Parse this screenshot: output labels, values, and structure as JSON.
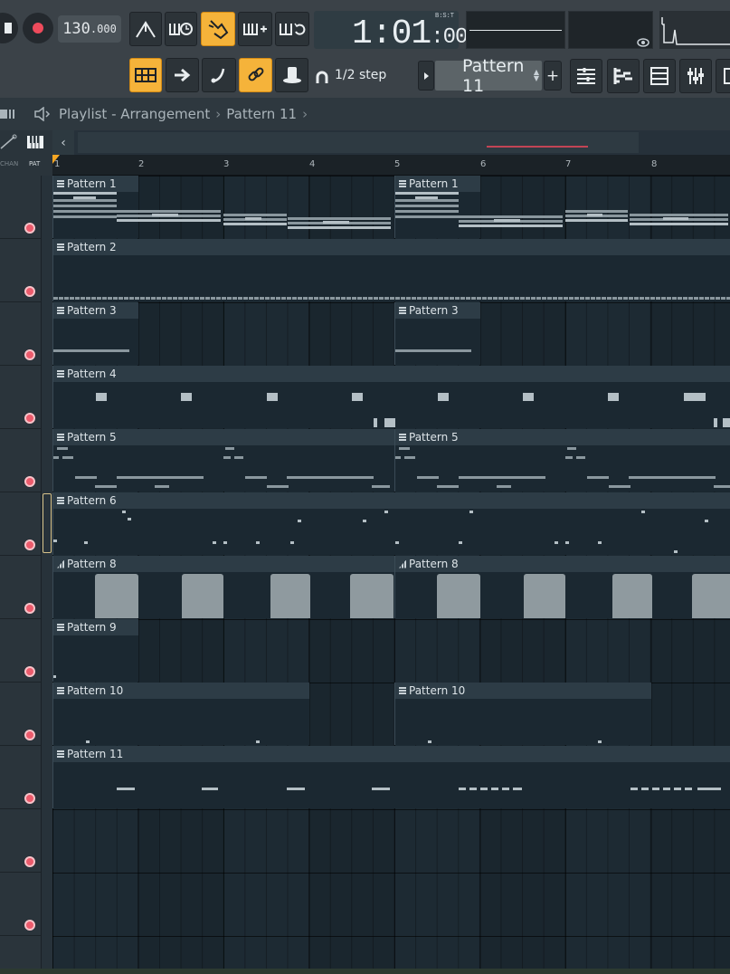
{
  "toolbar": {
    "tempo_main": "130",
    "tempo_fraction": ".000",
    "time_main": "1:01",
    "time_ticks": ":00",
    "time_format_label": "B:S:T",
    "snap_label": "1/2 step",
    "pattern_selector": "Pattern 11",
    "add_pattern_label": "+",
    "icons": [
      "stop-icon",
      "record-icon",
      "metronome-icon",
      "wait-for-input-icon",
      "step-edit-icon",
      "blend-notes-icon",
      "loop-record-icon",
      "playlist-view-icon",
      "arrow-icon",
      "slide-icon",
      "link-icon",
      "hat-icon",
      "magnet-icon",
      "arrow-right-icon",
      "channel-rack-icon",
      "piano-roll-icon",
      "browser-icon",
      "mixer-icon"
    ],
    "accent_color": "#f5b33a"
  },
  "titlebar": {
    "crumbs": [
      "Playlist - Arrangement",
      "Pattern 11"
    ],
    "separator": "›"
  },
  "tools": {
    "chan_label": "CHAN",
    "pat_label": "PAT"
  },
  "ruler": {
    "bars": [
      "1",
      "2",
      "3",
      "4",
      "5",
      "6",
      "7",
      "8"
    ]
  },
  "tracks": [
    {
      "clips": [
        {
          "label": "Pattern 1"
        },
        {
          "label": "Pattern 1"
        }
      ]
    },
    {
      "clips": [
        {
          "label": "Pattern 2"
        }
      ]
    },
    {
      "clips": [
        {
          "label": "Pattern 3"
        },
        {
          "label": "Pattern 3"
        }
      ]
    },
    {
      "clips": [
        {
          "label": "Pattern 4"
        }
      ]
    },
    {
      "clips": [
        {
          "label": "Pattern 5"
        },
        {
          "label": "Pattern 5"
        }
      ]
    },
    {
      "clips": [
        {
          "label": "Pattern 6"
        }
      ]
    },
    {
      "clips": [
        {
          "label": "Pattern 8"
        },
        {
          "label": "Pattern 8"
        }
      ]
    },
    {
      "clips": [
        {
          "label": "Pattern 9"
        }
      ]
    },
    {
      "clips": [
        {
          "label": "Pattern 10"
        },
        {
          "label": "Pattern 10"
        }
      ]
    },
    {
      "clips": [
        {
          "label": "Pattern 11"
        }
      ]
    },
    {
      "clips": []
    },
    {
      "clips": []
    }
  ]
}
